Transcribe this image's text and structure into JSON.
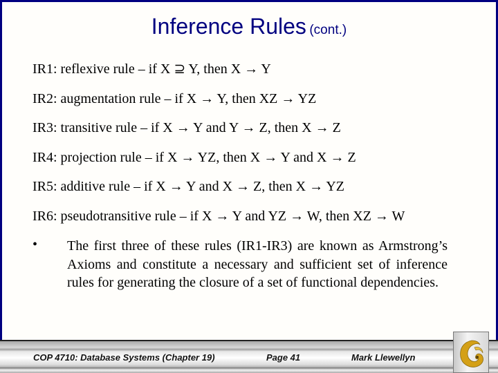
{
  "slide": {
    "title": "Inference Rules",
    "title_suffix": "(cont.)",
    "rules": [
      {
        "id": "IR1",
        "text": "IR1:  reflexive rule – if X ⊇ Y, then X → Y"
      },
      {
        "id": "IR2",
        "text": "IR2: augmentation rule – if X → Y, then XZ → YZ"
      },
      {
        "id": "IR3",
        "text": "IR3: transitive rule – if X → Y and Y → Z, then X → Z"
      },
      {
        "id": "IR4",
        "text": "IR4: projection rule – if X → YZ, then X → Y and X → Z"
      },
      {
        "id": "IR5",
        "text": "IR5: additive rule – if X → Y and X → Z, then X → YZ"
      },
      {
        "id": "IR6",
        "text": "IR6: pseudotransitive rule – if X → Y and YZ → W, then XZ → W"
      }
    ],
    "bullet_symbol": "•",
    "bullet_text": "The first three of these rules (IR1-IR3) are known as Armstrong’s Axioms and constitute a necessary and sufficient set of inference rules for generating the closure of a set of functional dependencies."
  },
  "footer": {
    "course": "COP 4710: Database Systems  (Chapter 19)",
    "page": "Page 41",
    "author": "Mark Llewellyn",
    "logo_icon": "pegasus-logo-icon"
  },
  "colors": {
    "title": "#000080",
    "frame_border": "#000080",
    "logo_gold": "#d4a017"
  }
}
